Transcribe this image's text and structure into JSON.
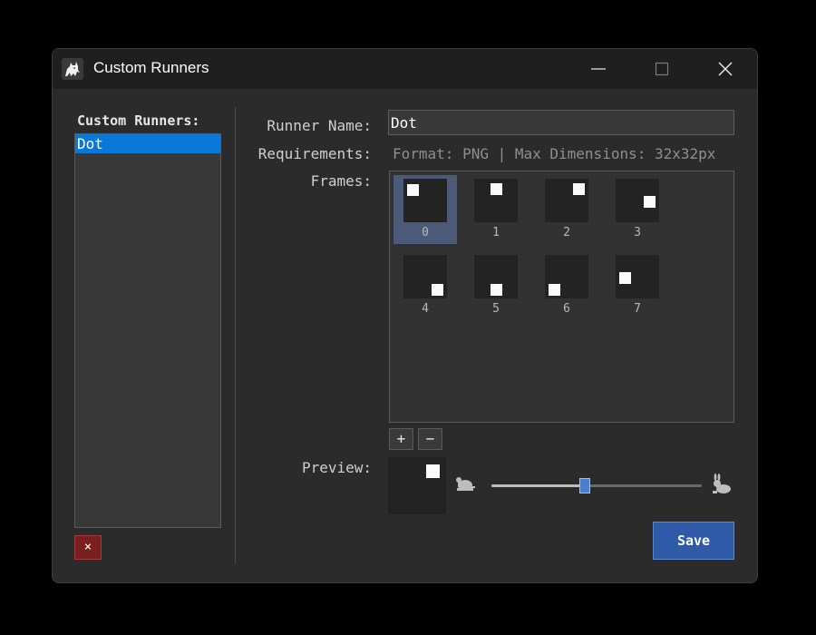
{
  "window": {
    "title": "Custom Runners",
    "icons": {
      "app": "cat-icon",
      "minimize": "minimize-icon",
      "maximize": "maximize-icon",
      "close": "close-icon"
    }
  },
  "sidebar": {
    "header": "Custom Runners:",
    "runners": [
      {
        "label": "Dot",
        "selected": true
      }
    ],
    "delete_label": "×"
  },
  "form": {
    "runner_name_label": "Runner Name:",
    "runner_name_value": "Dot",
    "requirements_label": "Requirements:",
    "requirements_text": "Format: PNG | Max Dimensions: 32x32px",
    "frames_label": "Frames:",
    "frames": [
      {
        "label": "0",
        "selected": true
      },
      {
        "label": "1"
      },
      {
        "label": "2"
      },
      {
        "label": "3"
      },
      {
        "label": "4"
      },
      {
        "label": "5"
      },
      {
        "label": "6"
      },
      {
        "label": "7"
      }
    ],
    "add_frame_label": "+",
    "remove_frame_label": "−",
    "preview_label": "Preview:",
    "speed_slider": {
      "value_fraction": 0.44,
      "min_icon": "turtle-icon",
      "max_icon": "rabbit-icon"
    },
    "save_label": "Save"
  },
  "colors": {
    "accent": "#0a78d7",
    "save": "#2e5aa8",
    "delete": "#7a1f1f",
    "slider_thumb": "#4a7fd0"
  }
}
